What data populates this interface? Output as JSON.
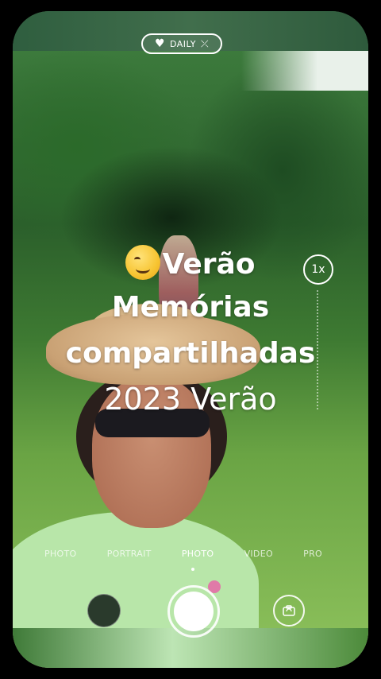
{
  "badge": {
    "label": "DAILY",
    "heart_icon": "heart-icon",
    "shuffle_icon": "shuffle-icon"
  },
  "caption": {
    "emoji": "smiling-face-emoji",
    "line1": "Verão",
    "line2": "Memórias",
    "line3": "compartilhadas",
    "line4": "2023 Verão"
  },
  "zoom": {
    "label": "1x"
  },
  "modes": {
    "items": [
      "PHOTO",
      "PORTRAIT",
      "PHOTO",
      "VIDEO",
      "PRO"
    ],
    "active_index": 2
  },
  "controls": {
    "gallery_icon": "gallery-thumbnail",
    "shutter_icon": "shutter-button",
    "flip_icon": "camera-flip-icon"
  },
  "colors": {
    "foliage": "#2c5a2e",
    "grass": "#88bd58",
    "overlay_text": "#ffffff"
  }
}
